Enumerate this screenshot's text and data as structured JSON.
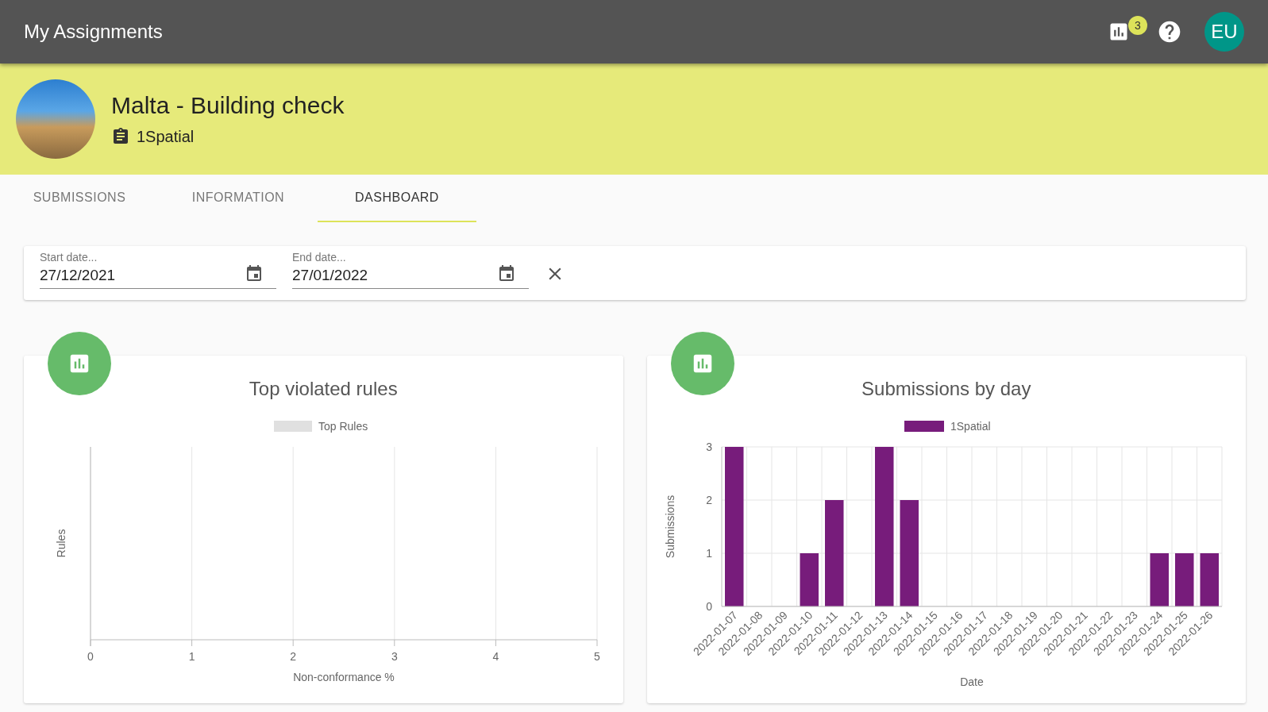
{
  "app_bar": {
    "title": "My Assignments",
    "notification_count": "3",
    "avatar_initials": "EU"
  },
  "assignment": {
    "title": "Malta - Building check",
    "organisation": "1Spatial"
  },
  "tabs": [
    {
      "label": "SUBMISSIONS",
      "selected": false
    },
    {
      "label": "INFORMATION",
      "selected": false
    },
    {
      "label": "DASHBOARD",
      "selected": true
    }
  ],
  "filters": [
    {
      "label": "Start date...",
      "value": "27/12/2021"
    },
    {
      "label": "End date...",
      "value": "27/01/2022"
    }
  ],
  "charts": [
    {
      "title": "Top violated rules",
      "chart_data": {
        "type": "bar",
        "orientation": "horizontal",
        "grid": true,
        "xlabel": "Non-conformance %",
        "ylabel": "Rules",
        "xlim": [
          0,
          5
        ],
        "xticks": [
          0,
          1,
          2,
          3,
          4,
          5
        ],
        "series": [
          {
            "name": "Top Rules",
            "color": "#e0e0e0"
          }
        ]
      }
    },
    {
      "title": "Submissions by day",
      "chart_data": {
        "type": "bar",
        "grid": true,
        "xlabel": "Date",
        "ylabel": "Submissions",
        "ylim": [
          0,
          3
        ],
        "yticks": [
          0,
          1,
          2,
          3
        ],
        "categories": [
          "2022-01-07",
          "2022-01-08",
          "2022-01-09",
          "2022-01-10",
          "2022-01-11",
          "2022-01-12",
          "2022-01-13",
          "2022-01-14",
          "2022-01-15",
          "2022-01-16",
          "2022-01-17",
          "2022-01-18",
          "2022-01-19",
          "2022-01-20",
          "2022-01-21",
          "2022-01-22",
          "2022-01-23",
          "2022-01-24",
          "2022-01-25",
          "2022-01-26"
        ],
        "series": [
          {
            "name": "1Spatial",
            "color": "#771c7b",
            "values": [
              3,
              0,
              0,
              1,
              2,
              0,
              3,
              2,
              0,
              0,
              0,
              0,
              0,
              0,
              0,
              0,
              0,
              1,
              1,
              1
            ]
          }
        ]
      }
    }
  ]
}
